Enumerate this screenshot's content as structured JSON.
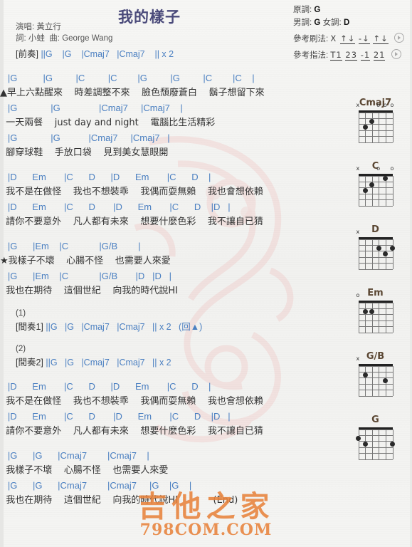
{
  "song": {
    "title": "我的樣子",
    "singer_label": "演唱:",
    "singer": "黃立行",
    "lyricist_label": "詞:",
    "lyricist": "小蛙",
    "composer_label": "曲:",
    "composer": "George Wang"
  },
  "meta": {
    "original_key_label": "原調:",
    "original_key": "G",
    "male_key_label": "男調:",
    "male_key": "G",
    "female_key_label": "女調:",
    "female_key": "D",
    "strum_label": "參考刷法:",
    "strum_pattern": "X ↑↓ -↓ ↑↓",
    "strum_tokens": [
      "X",
      "↑↓",
      "-↓",
      "↑↓"
    ],
    "fingerstyle_label": "參考指法:",
    "fingerstyle_pattern": "T1 23 -1 21",
    "fingerstyle_tokens": [
      "T1",
      "23",
      "-1",
      "21"
    ],
    "play_icon": "play-icon"
  },
  "intro": {
    "label": "[前奏]",
    "chords": "||G    |G    |Cmaj7   |Cmaj7    || x 2"
  },
  "interlude1": {
    "number": "(1)",
    "label": "[間奏1]",
    "chords": "||G   |G   |Cmaj7   |Cmaj7   || x 2   (回▲)"
  },
  "interlude2": {
    "number": "(2)",
    "label": "[間奏2]",
    "chords": "||G   |G   |Cmaj7   |Cmaj7   || x 2"
  },
  "sections": [
    {
      "name": "verse-1",
      "lines": [
        {
          "chords": "   |G          |G         |C         |C        |G         |G         |C        |C    |",
          "lyrics": "▲早上六點醒來    時差調整不來    臉色頹廢蒼白    鬍子想留下來"
        },
        {
          "chords": "   |G             |G               |Cmaj7     |Cmaj7    |",
          "lyrics": "  一天兩餐    just day and night    電腦比生活精彩"
        },
        {
          "chords": "   |G             |G           |Cmaj7     |Cmaj7   |",
          "lyrics": "  腳穿球鞋    手放口袋    見到美女慧眼開"
        }
      ]
    },
    {
      "name": "verse-2",
      "lines": [
        {
          "chords": "   |D      Em       |C      D      |D      Em       |C      D    |",
          "lyrics": "  我不是在做怪    我也不想裝乖    我偶而耍無賴    我也會想依賴"
        },
        {
          "chords": "   |D      Em       |C      D       |D      Em       |C      D    |D   |",
          "lyrics": "  請你不要意外    凡人都有未來    想要什麼色彩    我不讓自已猜"
        }
      ]
    },
    {
      "name": "chorus-1",
      "lines": [
        {
          "chords": "   |G      |Em    |C            |G/B        |",
          "lyrics": "★我樣子不壞    心腸不怪    也需要人來愛"
        },
        {
          "chords": "   |G      |Em    |C            |G/B       |D   |D   |",
          "lyrics": "  我也在期待    這個世紀    向我的時代說HI"
        }
      ]
    },
    {
      "name": "verse-3",
      "lines": [
        {
          "chords": "   |D      Em       |C      D      |D      Em       |C      D    |",
          "lyrics": "  我不是在做怪    我也不想裝乖    我偶而耍無賴    我也會想依賴"
        },
        {
          "chords": "   |D      Em       |C      D       |D      Em       |C      D    |D   |",
          "lyrics": "  請你不要意外    凡人都有未來    想要什麼色彩    我不讓自已猜"
        }
      ]
    },
    {
      "name": "chorus-final",
      "lines": [
        {
          "chords": "   |G      |G      |Cmaj7        |Cmaj7    |",
          "lyrics": "  我樣子不壞    心腸不怪    也需要人來愛"
        },
        {
          "chords": "   |G      |G      |Cmaj7        |Cmaj7     |G    |G    |",
          "lyrics": "  我也在期待    這個世紀    向我的時代說HI            (End)"
        }
      ]
    }
  ],
  "chord_diagrams": [
    {
      "name": "Cmaj7",
      "marks": [
        {
          "sym": "x",
          "string": 6
        },
        {
          "sym": "o",
          "string": 3
        },
        {
          "sym": "o",
          "string": 2
        },
        {
          "sym": "o",
          "string": 1
        }
      ],
      "dots": [
        {
          "string": 5,
          "fret": 3
        },
        {
          "string": 4,
          "fret": 2
        }
      ]
    },
    {
      "name": "C",
      "marks": [
        {
          "sym": "x",
          "string": 6
        },
        {
          "sym": "o",
          "string": 3
        },
        {
          "sym": "o",
          "string": 1
        }
      ],
      "dots": [
        {
          "string": 5,
          "fret": 3
        },
        {
          "string": 4,
          "fret": 2
        },
        {
          "string": 2,
          "fret": 1
        }
      ]
    },
    {
      "name": "D",
      "marks": [
        {
          "sym": "x",
          "string": 6
        }
      ],
      "dots": [
        {
          "string": 3,
          "fret": 2
        },
        {
          "string": 1,
          "fret": 2
        },
        {
          "string": 2,
          "fret": 3
        }
      ]
    },
    {
      "name": "Em",
      "marks": [
        {
          "sym": "o",
          "string": 6
        }
      ],
      "dots": [
        {
          "string": 5,
          "fret": 2
        },
        {
          "string": 4,
          "fret": 2
        }
      ]
    },
    {
      "name": "G/B",
      "marks": [
        {
          "sym": "x",
          "string": 6
        }
      ],
      "dots": [
        {
          "string": 5,
          "fret": 2
        },
        {
          "string": 2,
          "fret": 3
        }
      ]
    },
    {
      "name": "G",
      "marks": [],
      "dots": [
        {
          "string": 6,
          "fret": 2
        },
        {
          "string": 5,
          "fret": 3
        },
        {
          "string": 1,
          "fret": 3
        }
      ]
    }
  ],
  "watermark": {
    "chinese": "吉他之家",
    "site": "798COM.COM",
    "color": "#e8833c"
  }
}
